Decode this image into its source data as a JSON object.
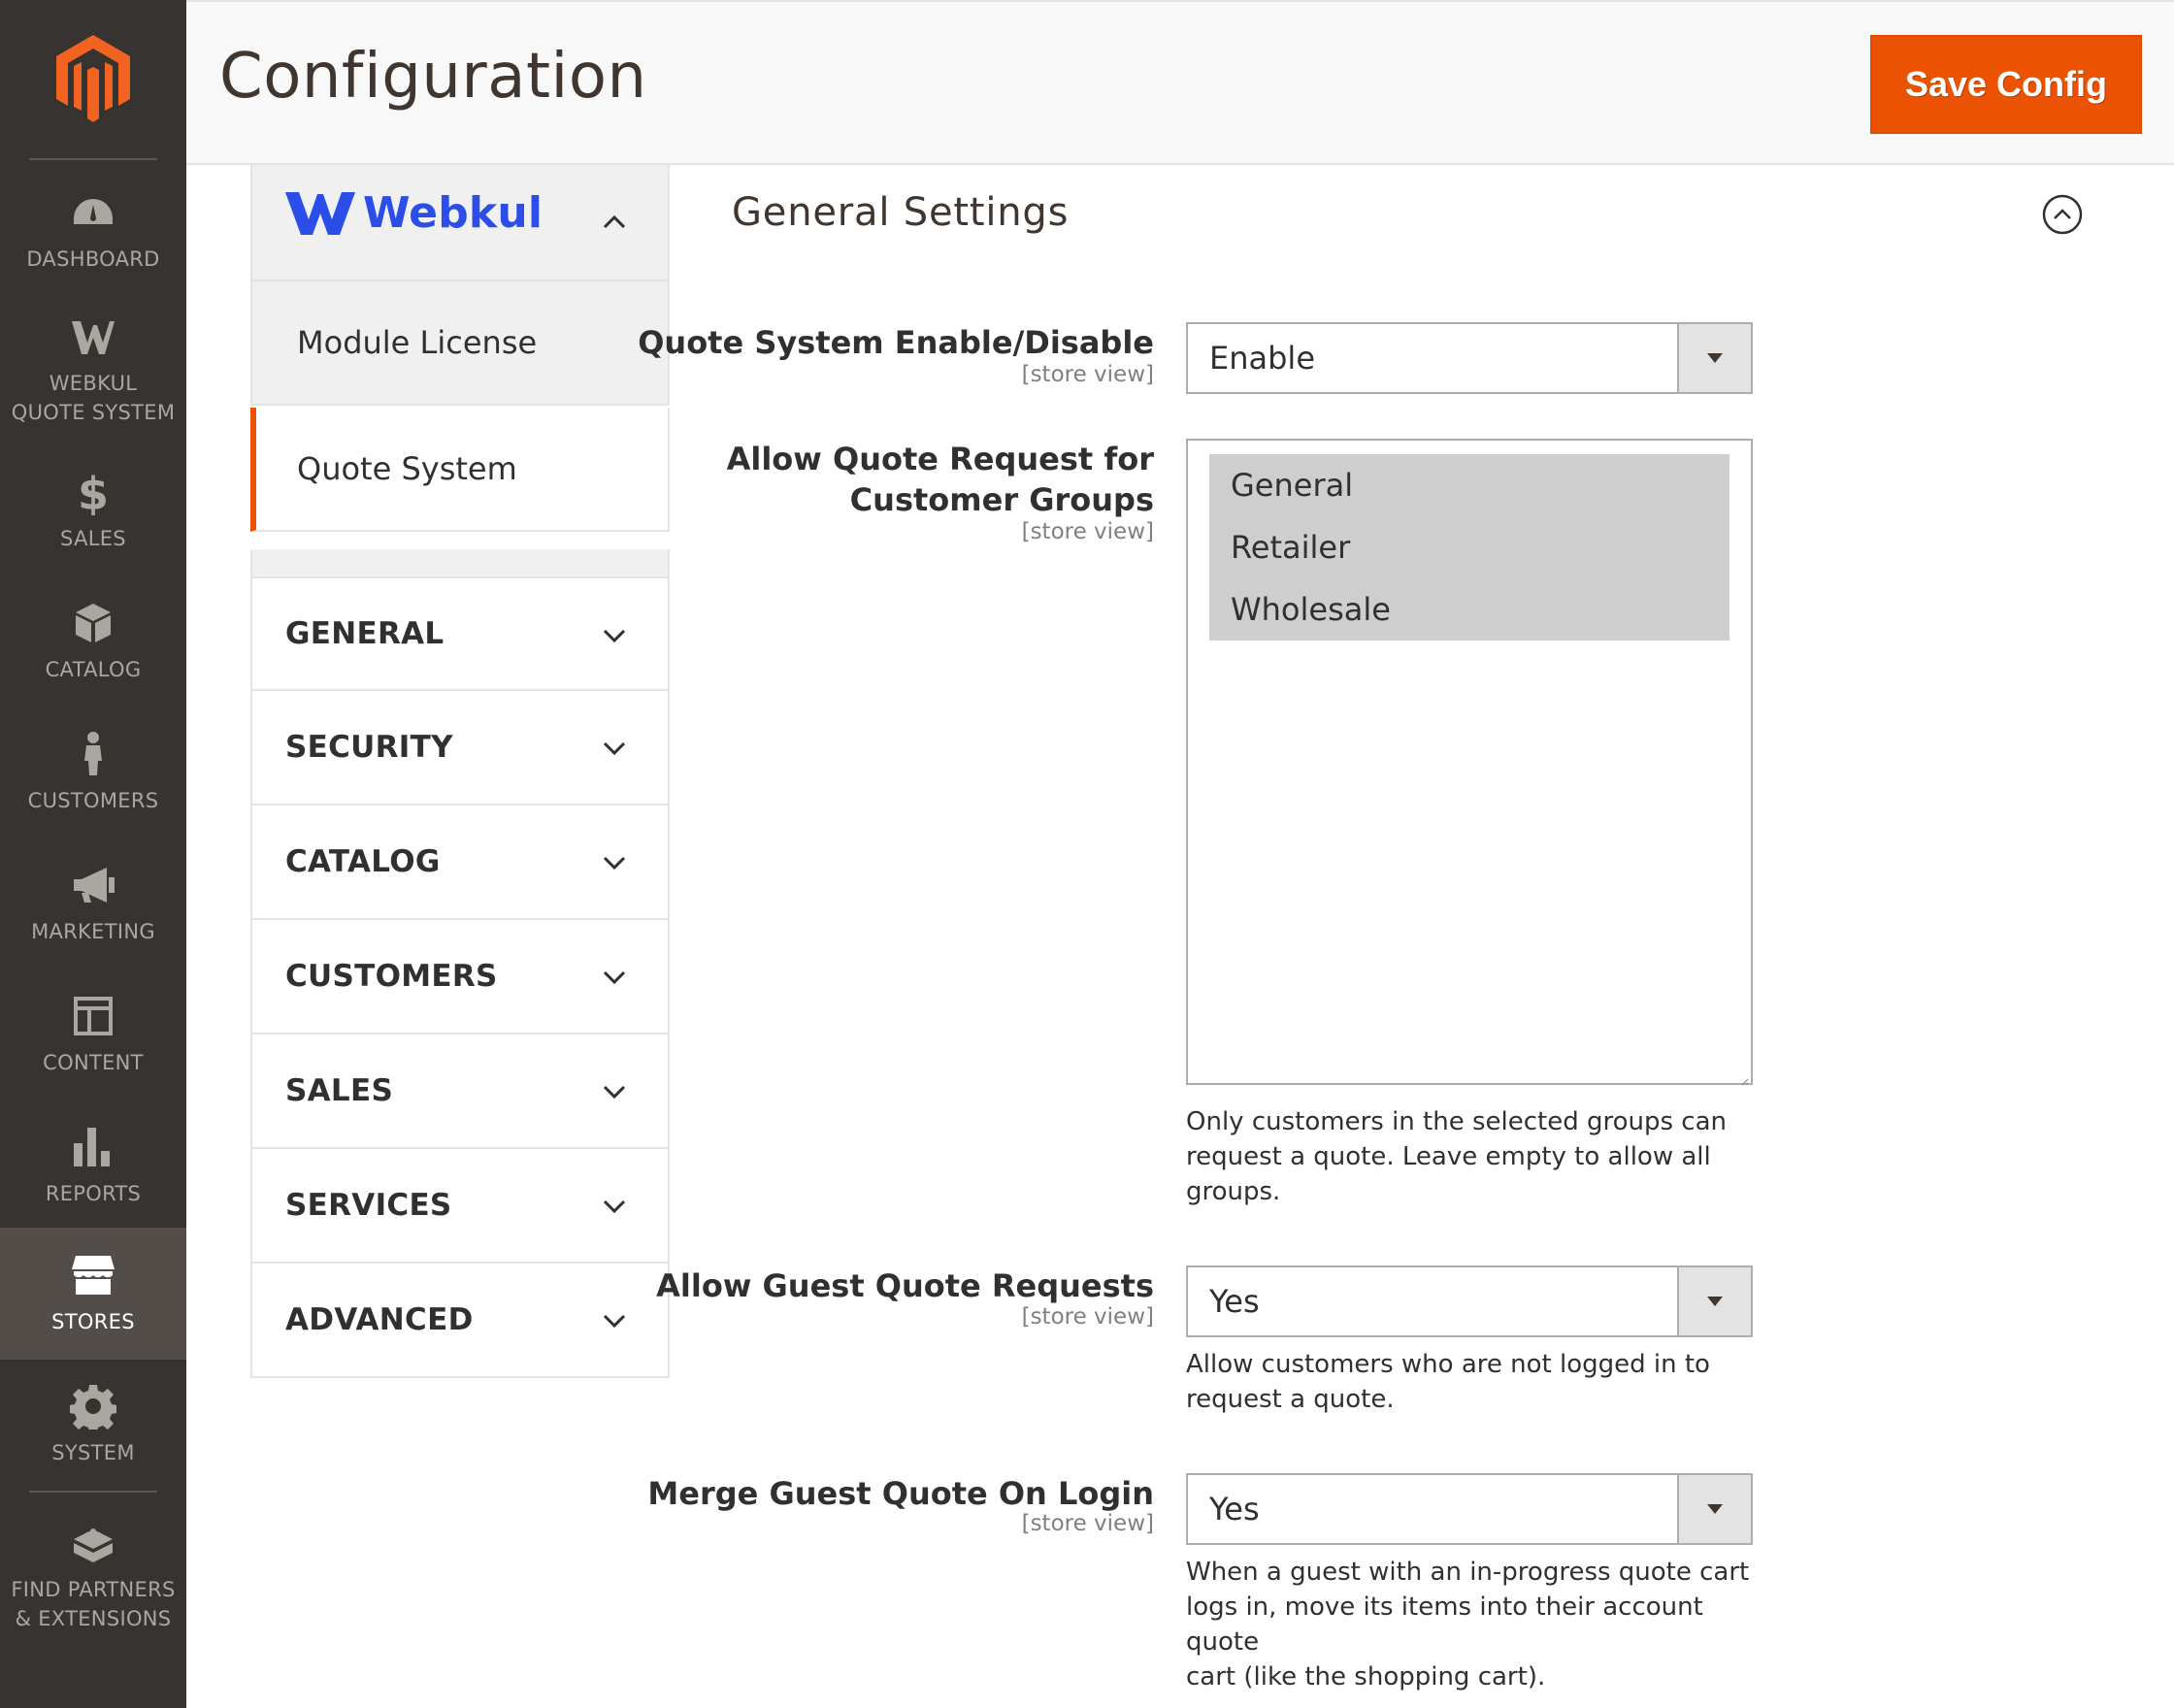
{
  "nav": {
    "items": [
      {
        "label": "DASHBOARD",
        "icon": "dashboard-icon"
      },
      {
        "label": "WEBKUL QUOTE SYSTEM",
        "line1": "WEBKUL",
        "line2": "QUOTE SYSTEM",
        "icon": "webkul-icon"
      },
      {
        "label": "SALES",
        "icon": "dollar-icon"
      },
      {
        "label": "CATALOG",
        "icon": "box-icon"
      },
      {
        "label": "CUSTOMERS",
        "icon": "person-icon"
      },
      {
        "label": "MARKETING",
        "icon": "megaphone-icon"
      },
      {
        "label": "CONTENT",
        "icon": "layout-icon"
      },
      {
        "label": "REPORTS",
        "icon": "bar-chart-icon"
      },
      {
        "label": "STORES",
        "icon": "store-icon",
        "active": true
      },
      {
        "label": "SYSTEM",
        "icon": "gear-icon"
      },
      {
        "label": "FIND PARTNERS & EXTENSIONS",
        "line1": "FIND PARTNERS",
        "line2": "& EXTENSIONS",
        "icon": "blocks-icon"
      }
    ]
  },
  "header": {
    "title": "Configuration",
    "save_label": "Save Config"
  },
  "config_tabs": {
    "vendor_name": "Webkul",
    "vendor_items": [
      "Module License",
      "Quote System"
    ],
    "active_item": "Quote System",
    "sections": [
      "GENERAL",
      "SECURITY",
      "CATALOG",
      "CUSTOMERS",
      "SALES",
      "SERVICES",
      "ADVANCED"
    ]
  },
  "form": {
    "section_title": "General Settings",
    "scope_label": "[store view]",
    "fields": {
      "enable": {
        "label": "Quote System Enable/Disable",
        "value": "Enable"
      },
      "groups": {
        "label_line1": "Allow Quote Request for",
        "label_line2": "Customer Groups",
        "options": [
          "General",
          "Retailer",
          "Wholesale"
        ],
        "selected": [
          "General",
          "Retailer",
          "Wholesale"
        ],
        "note_line1": "Only customers in the selected groups can",
        "note_line2": "request a quote. Leave empty to allow all",
        "note_line3": "groups."
      },
      "guest": {
        "label": "Allow Guest Quote Requests",
        "value": "Yes",
        "note_line1": "Allow customers who are not logged in to",
        "note_line2": "request a quote."
      },
      "merge": {
        "label": "Merge Guest Quote On Login",
        "value": "Yes",
        "note_line1": "When a guest with an in-progress quote cart",
        "note_line2": "logs in, move its items into their account quote",
        "note_line3": "cart (like the shopping cart)."
      }
    }
  },
  "colors": {
    "nav_bg": "#373330",
    "nav_active": "#524d49",
    "accent": "#eb5202",
    "webkul_blue": "#2b4de8"
  }
}
